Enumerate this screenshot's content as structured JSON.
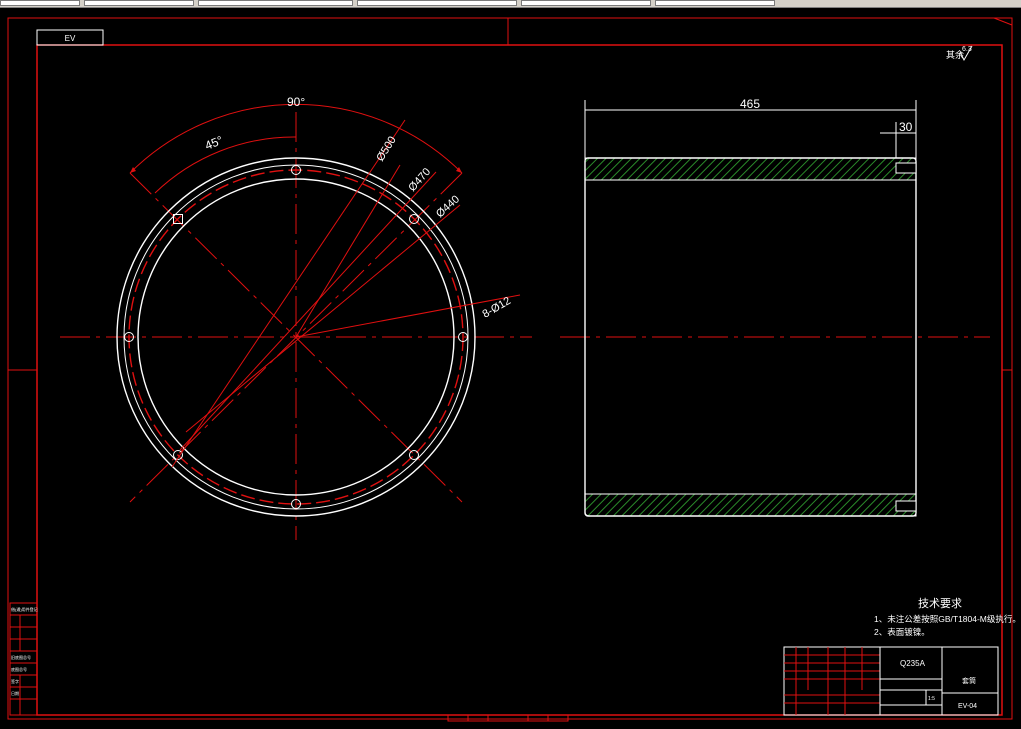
{
  "drawing": {
    "code_label": "EV",
    "roughness_note": "其余",
    "roughness_value": "6.3",
    "dimensions": {
      "angle_90": "90°",
      "angle_45": "45°",
      "dia_500": "Ø500",
      "dia_470": "Ø470",
      "dia_440": "Ø440",
      "holes": "8-Ø12",
      "length": "465",
      "groove": "30"
    },
    "tech_requirements": {
      "title": "技术要求",
      "item1": "1、未注公差按照GB/T1804-M级执行。",
      "item2": "2、表面镀镍。"
    },
    "title_block": {
      "material": "Q235A",
      "part_name": "套筒",
      "drawing_number": "EV-04",
      "scale": "1:5"
    },
    "side_labels": [
      "借(通)用件登记",
      "旧底图总号",
      "底图总号",
      "签字",
      "日期"
    ]
  }
}
